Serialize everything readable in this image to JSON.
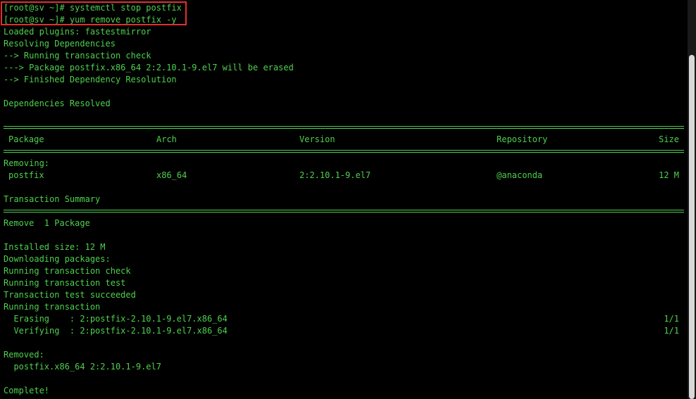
{
  "colors": {
    "text": "#4ed04e",
    "background": "#000000",
    "highlight_border": "#e03030",
    "scrollbar_thumb": "#d8d8d8"
  },
  "commands": [
    "[root@sv ~]# systemctl stop postfix",
    "[root@sv ~]# yum remove postfix -y"
  ],
  "output_top": [
    "Loaded plugins: fastestmirror",
    "Resolving Dependencies",
    "--> Running transaction check",
    "---> Package postfix.x86_64 2:2.10.1-9.el7 will be erased",
    "--> Finished Dependency Resolution",
    "",
    "Dependencies Resolved"
  ],
  "table": {
    "headers": {
      "package": "Package",
      "arch": "Arch",
      "version": "Version",
      "repository": "Repository",
      "size": "Size"
    },
    "section_label": "Removing:",
    "rows": [
      {
        "package": "postfix",
        "arch": "x86_64",
        "version": "2:2.10.1-9.el7",
        "repository": "@anaconda",
        "size": "12 M"
      }
    ]
  },
  "transaction_summary": {
    "title": "Transaction Summary",
    "remove_line": "Remove  1 Package"
  },
  "output_bottom": [
    "Installed size: 12 M",
    "Downloading packages:",
    "Running transaction check",
    "Running transaction test",
    "Transaction test succeeded",
    "Running transaction"
  ],
  "progress": [
    {
      "label": "  Erasing    : 2:postfix-2.10.1-9.el7.x86_64",
      "count": "1/1"
    },
    {
      "label": "  Verifying  : 2:postfix-2.10.1-9.el7.x86_64",
      "count": "1/1"
    }
  ],
  "removed": {
    "title": "Removed:",
    "item": "  postfix.x86_64 2:2.10.1-9.el7"
  },
  "complete": "Complete!"
}
